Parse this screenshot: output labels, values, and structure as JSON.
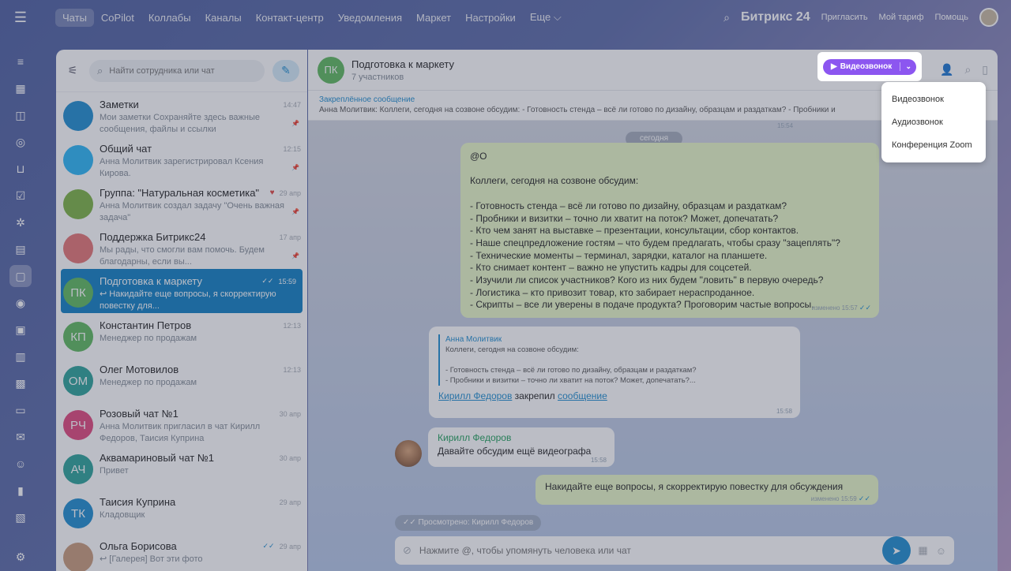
{
  "topnav": {
    "items": [
      "Чаты",
      "CoPilot",
      "Коллабы",
      "Каналы",
      "Контакт-центр",
      "Уведомления",
      "Маркет",
      "Настройки",
      "Еще ⌵"
    ],
    "brand": "Битрикс 24",
    "links": [
      "Пригласить",
      "Мой тариф",
      "Помощь"
    ]
  },
  "rail": {
    "icons": [
      "feed-icon",
      "tasks-calendar-icon",
      "groups-icon",
      "copilot-icon",
      "shop-icon",
      "checklist-icon",
      "crm-icon",
      "docs-icon",
      "chat-icon",
      "target-icon",
      "calendar-icon",
      "document-icon",
      "contacts-icon",
      "drive-icon",
      "mail-icon",
      "employees-icon",
      "analytics-icon",
      "id-card-icon",
      "settings-icon"
    ]
  },
  "list": {
    "search_placeholder": "Найти сотрудника или чат",
    "items": [
      {
        "initials": "",
        "title": "Заметки",
        "time": "14:47",
        "sub": "Мои заметки Сохраняйте здесь важные сообщения, файлы и ссылки",
        "color": "#1d8ccf",
        "pinned": true
      },
      {
        "initials": "",
        "title": "Общий чат",
        "time": "12:15",
        "sub": "Анна Молитвик зарегистрировал Ксения Кирова.",
        "color": "#29b6f6",
        "pinned": true
      },
      {
        "initials": "",
        "title": "Группа: \"Натуральная косметика\"",
        "time": "29 апр",
        "sub": "Анна Молитвик создал задачу \"Очень важная задача\"",
        "color": "#7cb342",
        "pinned": true
      },
      {
        "initials": "",
        "title": "Поддержка Битрикс24",
        "time": "17 апр",
        "sub": "Мы рады, что смогли вам помочь. Будем благодарны, если вы...",
        "color": "#e57373",
        "pinned": true
      },
      {
        "initials": "ПК",
        "title": "Подготовка к маркету",
        "time": "15:59",
        "sub": "↩ Накидайте еще вопросы, я скорректирую повестку для...",
        "color": "#5cb85c",
        "pinned": false
      },
      {
        "initials": "КП",
        "title": "Константин Петров",
        "time": "12:13",
        "sub": "Менеджер по продажам",
        "color": "#5cb85c",
        "pinned": false
      },
      {
        "initials": "ОМ",
        "title": "Олег Мотовилов",
        "time": "12:13",
        "sub": "Менеджер по продажам",
        "color": "#2aa198",
        "pinned": false
      },
      {
        "initials": "РЧ",
        "title": "Розовый чат №1",
        "time": "30 апр",
        "sub": "Анна Молитвик пригласил в чат Кирилл Федоров, Таисия Куприна",
        "color": "#e0457b",
        "pinned": false
      },
      {
        "initials": "АЧ",
        "title": "Аквамариновый чат №1",
        "time": "30 апр",
        "sub": "Привет",
        "color": "#2aa198",
        "pinned": false
      },
      {
        "initials": "ТК",
        "title": "Таисия Куприна",
        "time": "29 апр",
        "sub": "Кладовщик",
        "color": "#1d8ccf",
        "pinned": false
      },
      {
        "initials": "",
        "title": "Ольга Борисова",
        "time": "29 апр",
        "sub": "↩ [Галерея] Вот эти фото",
        "color": "#c89a7a",
        "pinned": false
      }
    ]
  },
  "chat": {
    "avatar": "ПК",
    "title": "Подготовка к маркету",
    "subtitle": "7 участников",
    "pinned_title": "Закреплённое сообщение",
    "pinned_text": "Анна Молитвик: Коллеги, сегодня на созвоне обсудим: - Готовность стенда – всё ли готово по дизайну, образцам и раздаткам? - Пробники и",
    "prev_time": "15:54",
    "date_pill": "сегодня",
    "big_message": {
      "lines": [
        "@О",
        "",
        "Коллеги, сегодня на созвоне обсудим:",
        "",
        "- Готовность стенда – всё ли готово по дизайну, образцам и раздаткам?",
        "- Пробники и визитки – точно ли хватит на поток? Может, допечатать?",
        "- Кто чем занят на выставке – презентации, консультации, сбор контактов.",
        "- Наше спецпредложение гостям – что будем предлагать, чтобы сразу \"зацеплять\"?",
        "- Технические моменты – терминал, зарядки, каталог на планшете.",
        "- Кто снимает контент – важно не упустить кадры для соцсетей.",
        "- Изучили ли список участников? Кого из них будем \"ловить\" в первую очередь?",
        "- Логистика – кто привозит товар, кто забирает нераспроданное.",
        "- Скрипты – все ли уверены в подаче продукта? Проговорим частые вопросы."
      ],
      "time": "изменено 15:57"
    },
    "quote_message": {
      "author": "Анна Молитвик",
      "lines": [
        "Коллеги, сегодня на созвоне обсудим:",
        "",
        "- Готовность стенда – всё ли готово по дизайну, образцам и раздаткам?",
        "- Пробники и визитки – точно ли хватит на поток? Может, допечатать?..."
      ],
      "foot_user": "Кирилл Федоров",
      "foot_text": " закрепил ",
      "foot_link": "сообщение",
      "time": "15:58"
    },
    "user_message": {
      "author": "Кирилл Федоров",
      "text": "Давайте обсудим ещё видеографа",
      "time": "15:58"
    },
    "reply_message": {
      "text": "Накидайте еще вопросы, я скорректирую повестку для обсуждения",
      "time": "изменено 15:59"
    },
    "seen": "Просмотрено: Кирилл Федоров",
    "composer_placeholder": "Нажмите @, чтобы упомянуть человека или чат"
  },
  "video": {
    "label": "Видеозвонок",
    "menu": [
      "Видеозвонок",
      "Аудиозвонок",
      "Конференция Zoom"
    ]
  },
  "colors": {
    "accent": "#1d8ccf",
    "video": "#8c56f0",
    "bubble": "#e8f7c6"
  }
}
